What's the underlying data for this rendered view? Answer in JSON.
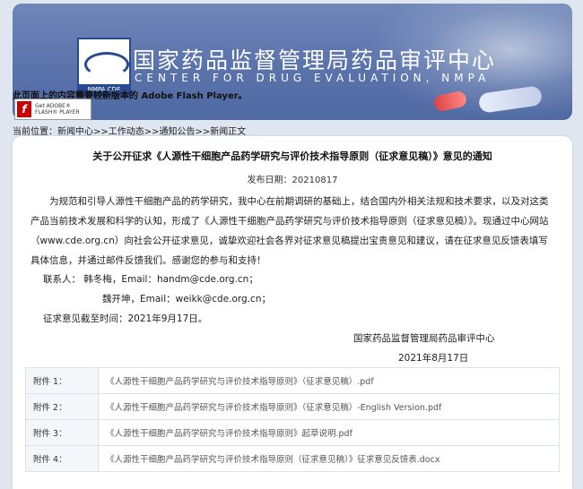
{
  "header": {
    "title_cn": "国家药品监督管理局药品审评中心",
    "title_en": "CENTER FOR DRUG EVALUATION, NMPA",
    "logo_caption": "NMPA CDE"
  },
  "flash": {
    "notice": "此页面上的内容需要较新版本的 Adobe Flash Player。",
    "button_line1": "Get ADOBE®",
    "button_line2": "FLASH® PLAYER"
  },
  "breadcrumb": {
    "prefix": "当前位置：",
    "items": [
      "新闻中心",
      "工作动态",
      "通知公告",
      "新闻正文"
    ],
    "sep": ">>"
  },
  "article": {
    "title": "关于公开征求《人源性干细胞产品药学研究与评价技术指导原则（征求意见稿）》意见的通知",
    "pub_label": "发布日期：",
    "pub_date": "20210817",
    "body": "为规范和引导人源性干细胞产品的药学研究，我中心在前期调研的基础上，结合国内外相关法规和技术要求，以及对这类产品当前技术发展和科学的认知，形成了《人源性干细胞产品药学研究与评价技术指导原则（征求意见稿）》。现通过中心网站（www.cde.org.cn）向社会公开征求意见，诚挚欢迎社会各界对征求意见稿提出宝贵意见和建议，请在征求意见反馈表填写具体信息，并通过邮件反馈我们。感谢您的参与和支持！",
    "contact1": "联系人：  韩冬梅，Email：handm@cde.org.cn；",
    "contact2": "魏开坤，Email：weikk@cde.org.cn；",
    "deadline": "征求意见截至时间：2021年9月17日。",
    "signature_org": "国家药品监督管理局药品审评中心",
    "signature_date": "2021年8月17日"
  },
  "attachments": [
    {
      "label": "附件 1：",
      "file": "《人源性干细胞产品药学研究与评价技术指导原则》（征求意见稿）.pdf"
    },
    {
      "label": "附件 2：",
      "file": "《人源性干细胞产品药学研究与评价技术指导原则》（征求意见稿）-English Version.pdf"
    },
    {
      "label": "附件 3：",
      "file": "《人源性干细胞产品药学研究与评价技术指导原则》起草说明.pdf"
    },
    {
      "label": "附件 4：",
      "file": "《人源性干细胞产品药学研究与评价技术指导原则（征求意见稿）》征求意见反馈表.docx"
    }
  ]
}
